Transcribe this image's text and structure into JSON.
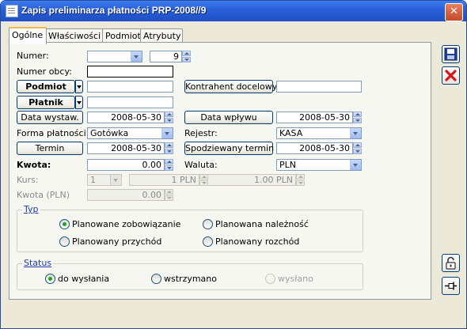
{
  "window": {
    "title": "Zapis preliminarza płatności PRP-2008//9",
    "close_label": "✕"
  },
  "tabs": [
    {
      "label": "Ogólne"
    },
    {
      "label": "Właściwości"
    },
    {
      "label": "Podmiot"
    },
    {
      "label": "Atrybuty"
    }
  ],
  "form": {
    "numer_label": "Numer:",
    "numer_series": "",
    "numer_value": "9",
    "numer_obcy_label": "Numer obcy:",
    "numer_obcy_value": "",
    "podmiot_button": "Podmiot",
    "podmiot_value": "",
    "kontrahent_button": "Kontrahent docelowy",
    "kontrahent_value": "",
    "platnik_button": "Płatnik",
    "platnik_value": "",
    "data_wystaw_button": "Data wystaw.",
    "data_wystaw_value": "2008-05-30",
    "data_wplywu_button": "Data wpływu",
    "data_wplywu_value": "2008-05-30",
    "forma_label": "Forma płatności:",
    "forma_value": "Gotówka",
    "rejestr_label": "Rejestr:",
    "rejestr_value": "KASA",
    "termin_button": "Termin",
    "termin_value": "2008-05-30",
    "spodziewany_button": "Spodziewany termin",
    "spodziewany_value": "2008-05-30",
    "kwota_label": "Kwota:",
    "kwota_value": "0.00",
    "waluta_label": "Waluta:",
    "waluta_value": "PLN",
    "kurs_label": "Kurs:",
    "kurs_select": "1",
    "kurs_value1": "1 PLN",
    "kurs_value2": "1.00 PLN",
    "kwota_pln_label": "Kwota (PLN)",
    "kwota_pln_value": "0.00"
  },
  "typ": {
    "title": "Typ",
    "options": [
      {
        "label": "Planowane zobowiązanie",
        "selected": true
      },
      {
        "label": "Planowana należność",
        "selected": false
      },
      {
        "label": "Planowany przychód",
        "selected": false
      },
      {
        "label": "Planowany rozchód",
        "selected": false
      }
    ]
  },
  "status": {
    "title": "Status",
    "options": [
      {
        "label": "do wysłania",
        "selected": true,
        "enabled": true
      },
      {
        "label": "wstrzymano",
        "selected": false,
        "enabled": true
      },
      {
        "label": "wysłano",
        "selected": false,
        "enabled": false
      }
    ]
  },
  "side_buttons": [
    "save-icon",
    "delete-icon",
    "lock-icon",
    "pin-icon"
  ]
}
